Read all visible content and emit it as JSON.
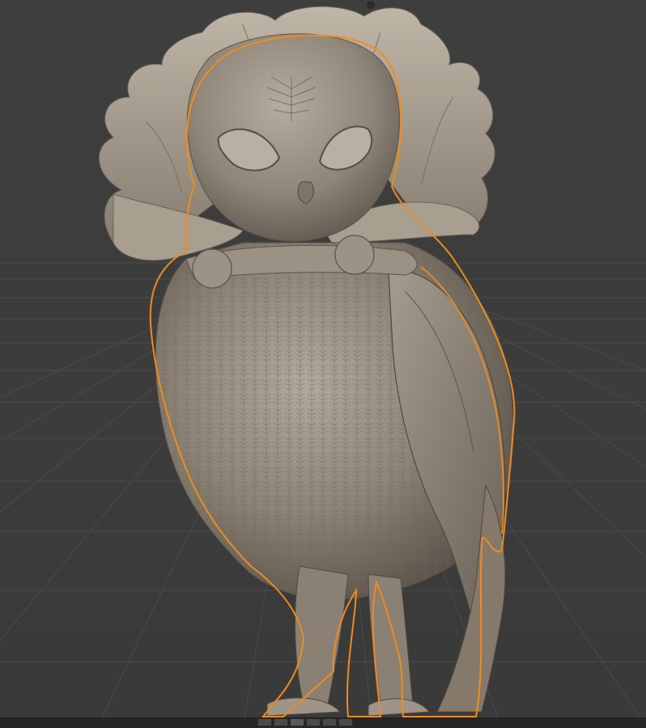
{
  "app": {
    "view": "3D viewport",
    "mode": "sculpt"
  },
  "viewport": {
    "background_color": "#3d3d3d",
    "grid_color": "#4a4a4a",
    "model_color": "#8d8376",
    "selection_outline_color": "#f08c1c",
    "object": "owl-sculpt",
    "grid": true
  },
  "toolbar": {
    "buttons": [
      "viewport-tool-1",
      "viewport-tool-2",
      "viewport-tool-3",
      "viewport-tool-4",
      "viewport-tool-5",
      "viewport-tool-6"
    ],
    "active_index": 2
  }
}
